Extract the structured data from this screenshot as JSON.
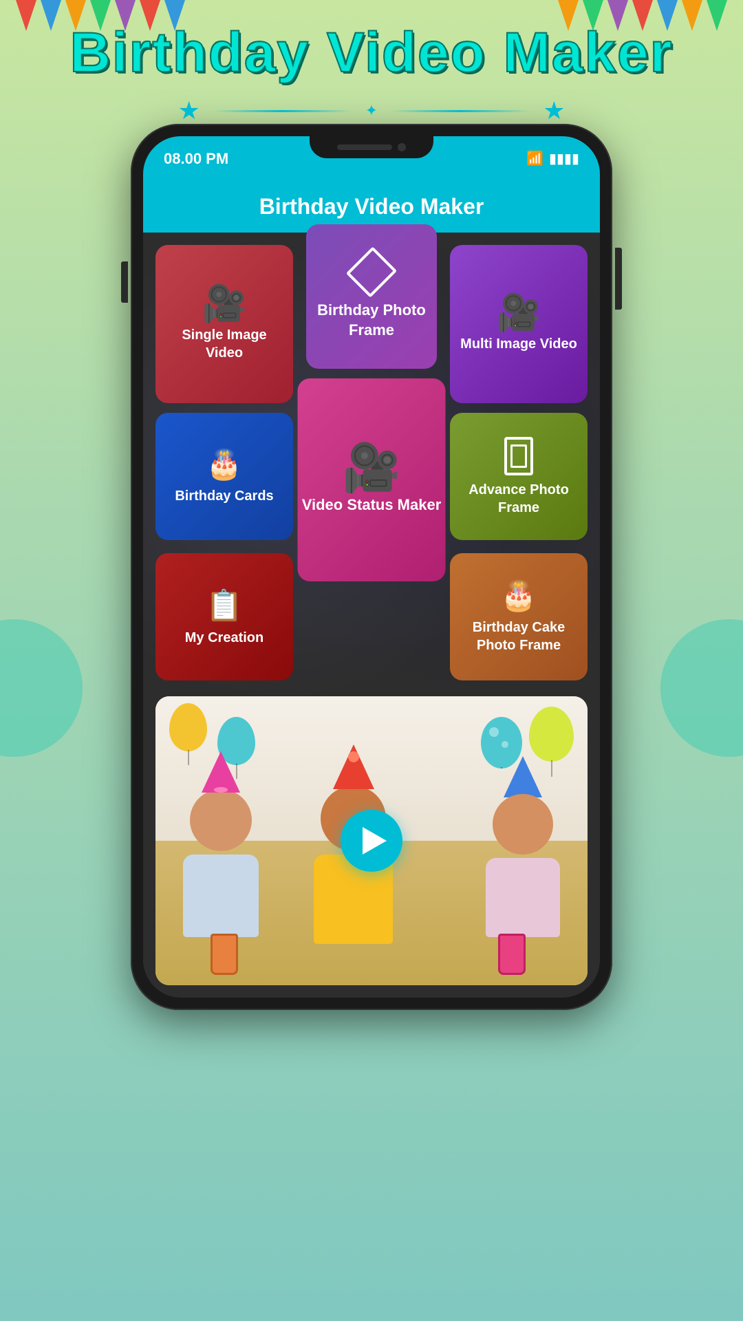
{
  "app": {
    "title": "Birthday Video Maker",
    "status_bar": {
      "time": "08.00 PM",
      "wifi": "wifi",
      "battery": "battery"
    }
  },
  "main_title": "Birthday Video Maker",
  "grid": {
    "row1": {
      "single_image_video": {
        "label": "Single Image Video",
        "icon": "camera"
      },
      "birthday_photo_frame": {
        "label": "Birthday Photo Frame",
        "icon": "frame"
      },
      "multi_image_video": {
        "label": "Multi Image Video",
        "icon": "camera"
      }
    },
    "row2": {
      "birthday_cards": {
        "label": "Birthday Cards",
        "icon": "birthday-card"
      },
      "video_status_maker": {
        "label": "Video Status Maker",
        "icon": "camera"
      },
      "advance_photo_frame": {
        "label": "Advance Photo Frame",
        "icon": "frame"
      }
    },
    "row3": {
      "my_creation": {
        "label": "My Creation",
        "icon": "document"
      },
      "birthday_cake_photo_frame": {
        "label": "Birthday Cake Photo Frame",
        "icon": "cake"
      }
    }
  },
  "video_preview": {
    "play_button": "▶"
  },
  "stars": [
    "★",
    "★",
    "★"
  ],
  "colors": {
    "teal": "#00bcd4",
    "single_image_bg": "#c0404a",
    "birthday_frame_bg": "#7c4db8",
    "multi_image_bg": "#8e44cc",
    "birthday_cards_bg": "#1a56cc",
    "video_status_bg": "#d44090",
    "advance_photo_bg": "#7a9c30",
    "my_creation_bg": "#b02020",
    "birthday_cake_bg": "#c07030"
  }
}
